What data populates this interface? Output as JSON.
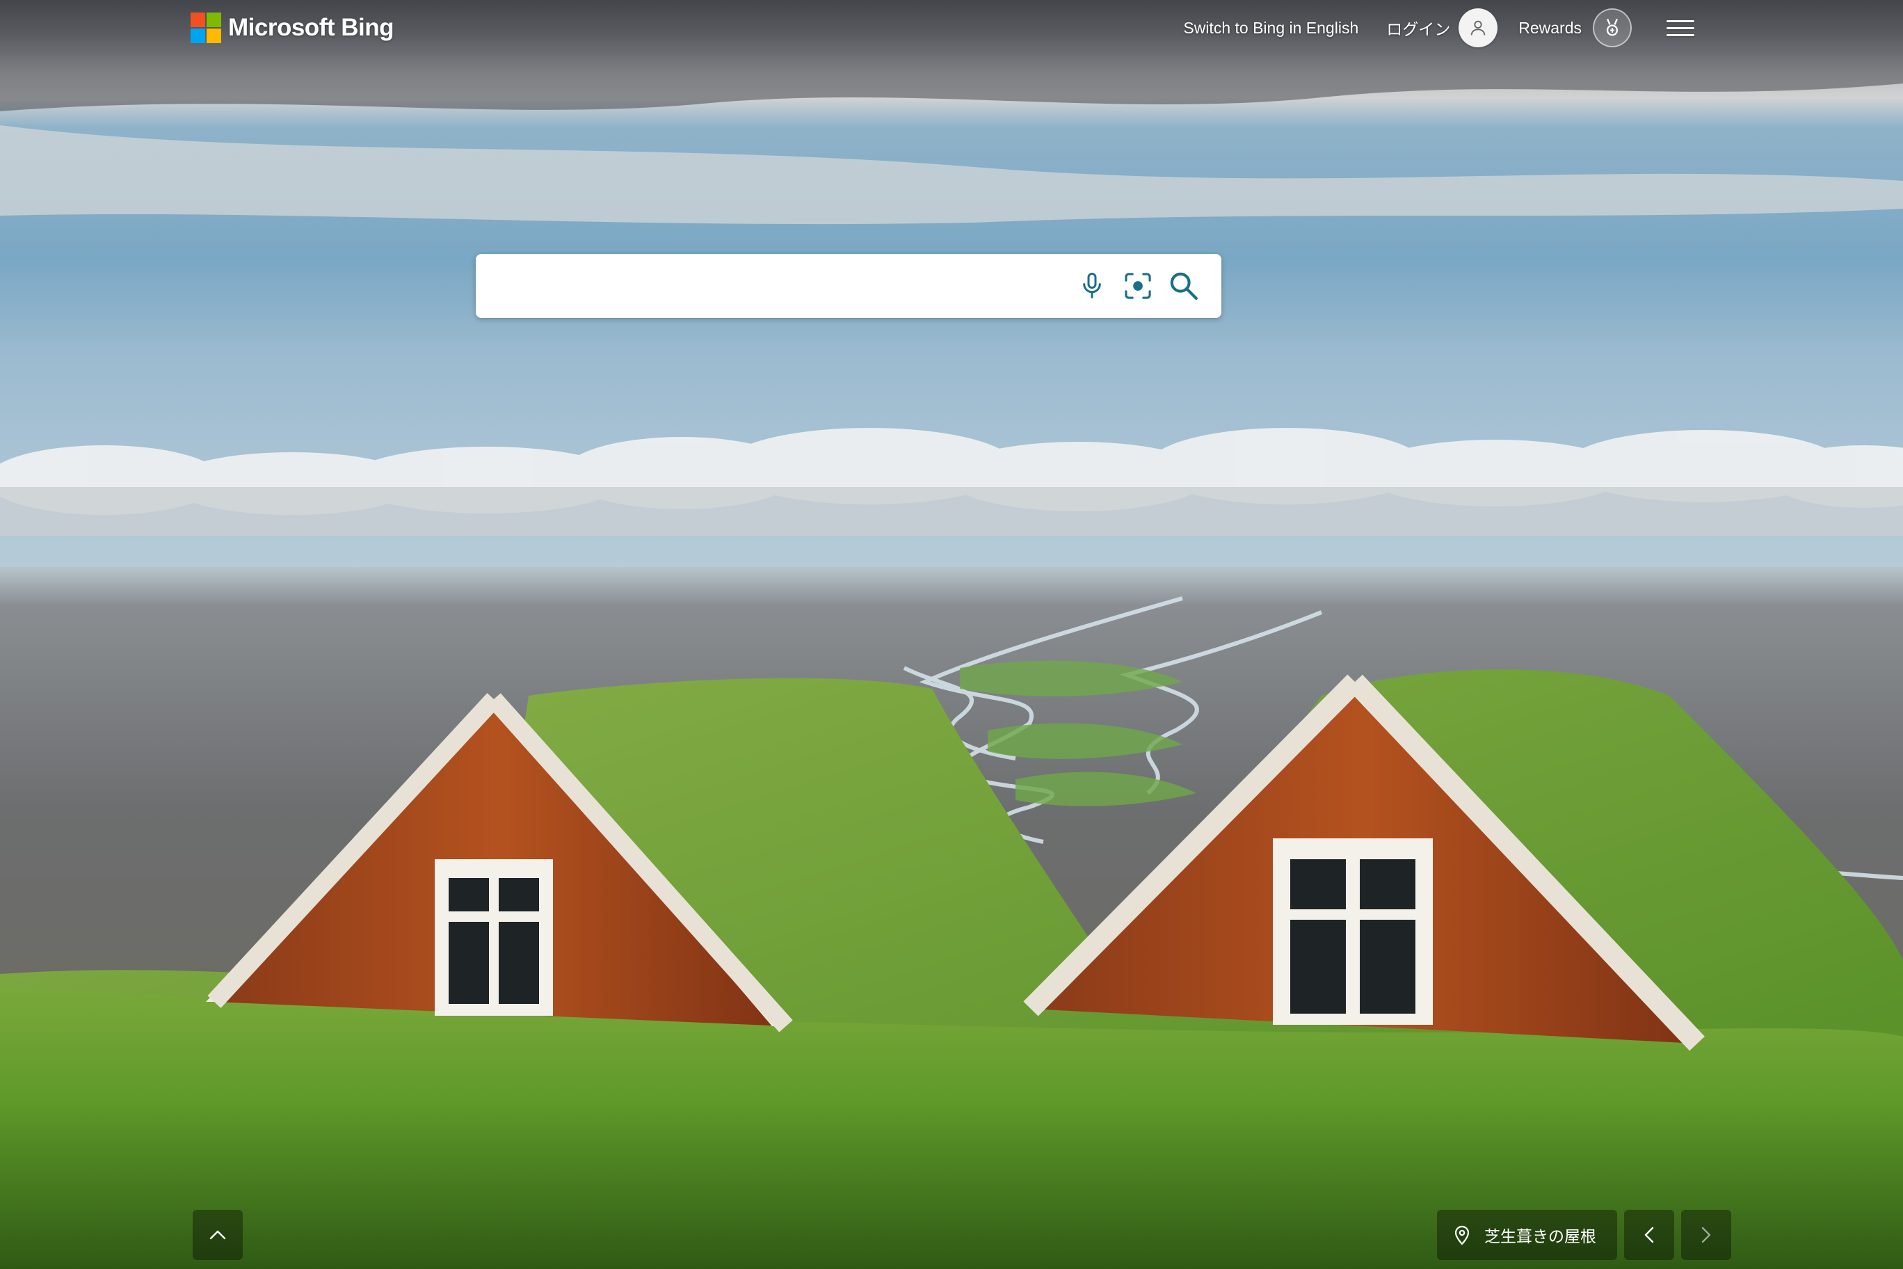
{
  "header": {
    "logo_text": "Microsoft Bing",
    "switch_language_label": "Switch to Bing in English",
    "login_label": "ログイン",
    "rewards_label": "Rewards"
  },
  "search": {
    "value": "",
    "placeholder": ""
  },
  "image_info": {
    "caption": "芝生葺きの屋根"
  },
  "icons": {
    "logo": "microsoft-logo-icon",
    "avatar": "user-avatar-icon",
    "rewards": "rewards-medal-icon",
    "menu": "hamburger-menu-icon",
    "voice": "microphone-icon",
    "visual": "visual-search-icon",
    "search": "search-icon",
    "scroll_up": "chevron-up-icon",
    "location": "location-pin-icon",
    "prev": "chevron-left-icon",
    "next": "chevron-right-icon"
  },
  "colors": {
    "ms_red": "#f25022",
    "ms_green": "#7fba00",
    "ms_blue": "#00a4ef",
    "ms_yellow": "#ffb900",
    "search_icon_teal": "#1a6f87"
  }
}
